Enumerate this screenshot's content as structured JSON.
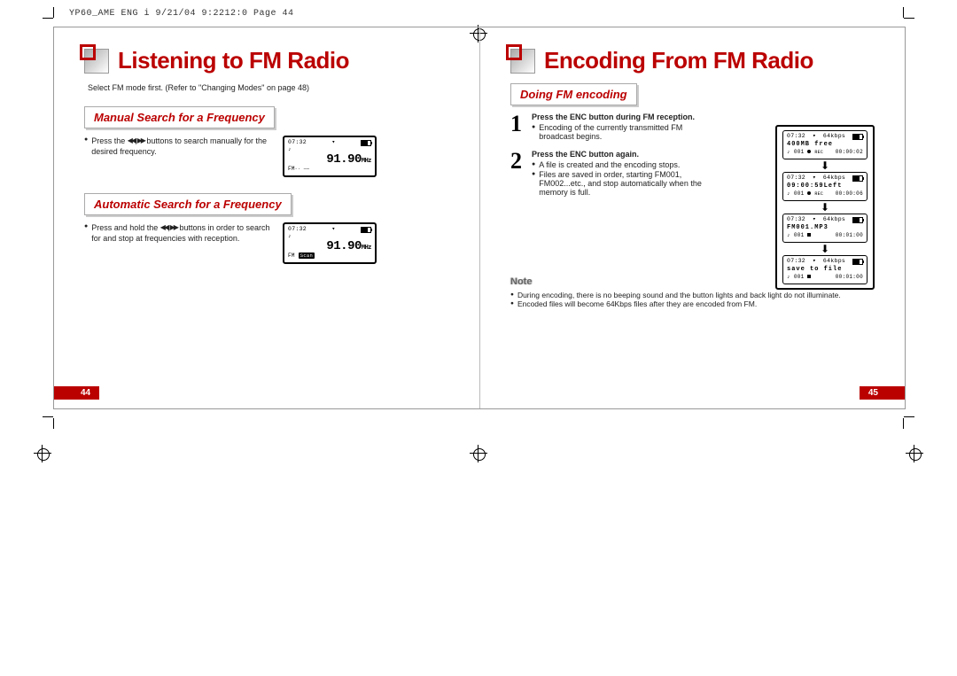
{
  "header_note": "YP60_AME ENG i  9/21/04 9:2212:0  Page 44",
  "left": {
    "title": "Listening to FM Radio",
    "intro": "Select FM mode first. (Refer to \"Changing Modes\" on  page 48)",
    "sub1": "Manual Search for a Frequency",
    "sub1_text_a": "Press the ",
    "sub1_text_b": " buttons to search manually for the desired frequency.",
    "sub2": "Automatic Search for a Frequency",
    "sub2_text_a": "Press and hold the ",
    "sub2_text_b": " buttons in order to search for and stop at frequencies with reception.",
    "lcd": {
      "time": "07:32",
      "freq": "91.90",
      "unit": "MHz",
      "fm": "FM",
      "scan": "Scan"
    },
    "page_num": "44"
  },
  "right": {
    "title": "Encoding From FM Radio",
    "sub": "Doing FM encoding",
    "step1_hd": "Press the ENC button during FM reception.",
    "step1_b1": "Encoding of the currently transmitted FM broadcast begins.",
    "step2_hd": "Press the ENC button again.",
    "step2_b1": "A file is created and the encoding stops.",
    "step2_b2": "Files are saved in order, starting FM001, FM002...etc., and stop automatically when the memory is full.",
    "note_hd": "Note",
    "note1": "During encoding, there is no beeping sound and the button lights and back light do not illuminate.",
    "note2": "Encoded files will become 64Kbps files after they are encoded from FM.",
    "lcds": {
      "time": "07:32",
      "rate": "64kbps",
      "l1": "400MB free",
      "l2": "09:00:59Left",
      "l3": "FM001.MP3",
      "l4": "save to file",
      "bot_a": "001",
      "t1": "00:00:02",
      "t2": "00:00:06",
      "t3": "00:01:00",
      "t4": "00:01:00"
    },
    "page_num": "45"
  }
}
